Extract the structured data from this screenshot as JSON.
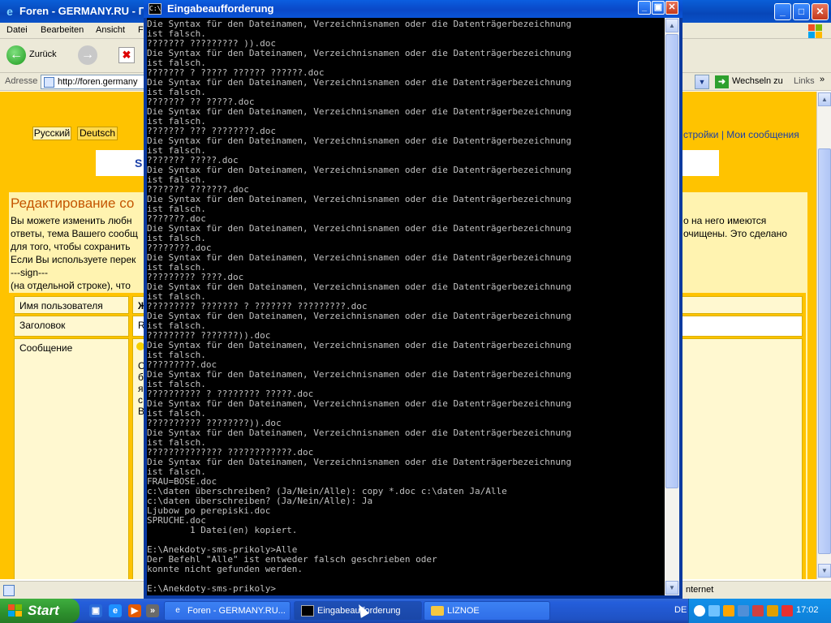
{
  "ie": {
    "title": "Foren - GERMANY.RU - Г",
    "menu": [
      "Datei",
      "Bearbeiten",
      "Ansicht",
      "F"
    ],
    "back_label": "Zurück",
    "address_label": "Adresse",
    "address_value": "http://foren.germany",
    "go_label": "Wechseln zu",
    "links_label": "Links",
    "lang_russian": "Русский",
    "lang_deutsch": "Deutsch",
    "strip_letter": "S",
    "user_links": "стройки | Мои сообщения",
    "edit_title": "Редактирование со",
    "desc_lines": [
      "Вы можете изменить любн",
      "ответы, тема Вашего сообщ",
      "для того, чтобы сохранить",
      "Если Вы используете перек",
      "---sign---",
      "(на отдельной строке), что"
    ],
    "desc_right_lines": [
      "о на него имеются",
      "очищены. Это сделано"
    ],
    "form": {
      "username_label": "Имя пользователя",
      "username_value": "Ж",
      "subject_label": "Заголовок",
      "subject_value": "R",
      "message_label": "Сообщение",
      "message_preview": [
        "С",
        "б",
        "я",
        "с",
        "В"
      ]
    },
    "status_zone": "nternet"
  },
  "cmd": {
    "title": "Eingabeaufforderung",
    "icon_text": "C:\\",
    "output": "Die Syntax für den Dateinamen, Verzeichnisnamen oder die Datenträgerbezeichnung\nist falsch.\n??????? ????????? )).doc\nDie Syntax für den Dateinamen, Verzeichnisnamen oder die Datenträgerbezeichnung\nist falsch.\n??????? ? ????? ?????? ??????.doc\nDie Syntax für den Dateinamen, Verzeichnisnamen oder die Datenträgerbezeichnung\nist falsch.\n??????? ?? ?????.doc\nDie Syntax für den Dateinamen, Verzeichnisnamen oder die Datenträgerbezeichnung\nist falsch.\n??????? ??? ????????.doc\nDie Syntax für den Dateinamen, Verzeichnisnamen oder die Datenträgerbezeichnung\nist falsch.\n??????? ?????.doc\nDie Syntax für den Dateinamen, Verzeichnisnamen oder die Datenträgerbezeichnung\nist falsch.\n??????? ???????.doc\nDie Syntax für den Dateinamen, Verzeichnisnamen oder die Datenträgerbezeichnung\nist falsch.\n???????.doc\nDie Syntax für den Dateinamen, Verzeichnisnamen oder die Datenträgerbezeichnung\nist falsch.\n????????.doc\nDie Syntax für den Dateinamen, Verzeichnisnamen oder die Datenträgerbezeichnung\nist falsch.\n????????? ????.doc\nDie Syntax für den Dateinamen, Verzeichnisnamen oder die Datenträgerbezeichnung\nist falsch.\n????????? ??????? ? ??????? ?????????.doc\nDie Syntax für den Dateinamen, Verzeichnisnamen oder die Datenträgerbezeichnung\nist falsch.\n????????? ???????)).doc\nDie Syntax für den Dateinamen, Verzeichnisnamen oder die Datenträgerbezeichnung\nist falsch.\n?????????.doc\nDie Syntax für den Dateinamen, Verzeichnisnamen oder die Datenträgerbezeichnung\nist falsch.\n?????????? ? ???????? ?????.doc\nDie Syntax für den Dateinamen, Verzeichnisnamen oder die Datenträgerbezeichnung\nist falsch.\n?????????? ????????)).doc\nDie Syntax für den Dateinamen, Verzeichnisnamen oder die Datenträgerbezeichnung\nist falsch.\n?????????????? ????????????.doc\nDie Syntax für den Dateinamen, Verzeichnisnamen oder die Datenträgerbezeichnung\nist falsch.\nFRAU=BOSE.doc\nc:\\daten überschreiben? (Ja/Nein/Alle): copy *.doc c:\\daten Ja/Alle\nc:\\daten überschreiben? (Ja/Nein/Alle): Ja\nLjubow po perepiski.doc\nSPRUCHE.doc\n        1 Datei(en) kopiert.\n\nE:\\Anekdoty-sms-prikoly>Alle\nDer Befehl \"Alle\" ist entweder falsch geschrieben oder\nkonnte nicht gefunden werden.\n\nE:\\Anekdoty-sms-prikoly>"
  },
  "taskbar": {
    "start_label": "Start",
    "tasks": [
      {
        "label": "Foren - GERMANY.RU..."
      },
      {
        "label": "Eingabeaufforderung"
      },
      {
        "label": "LIZNOE"
      }
    ],
    "lang": "DE",
    "clock": "17:02"
  },
  "colors": {
    "xp_blue": "#0a52c8",
    "forum_gold": "#ffc300",
    "console_bg": "#000000",
    "console_fg": "#c0c0c0",
    "start_green": "#2d8f2d"
  }
}
